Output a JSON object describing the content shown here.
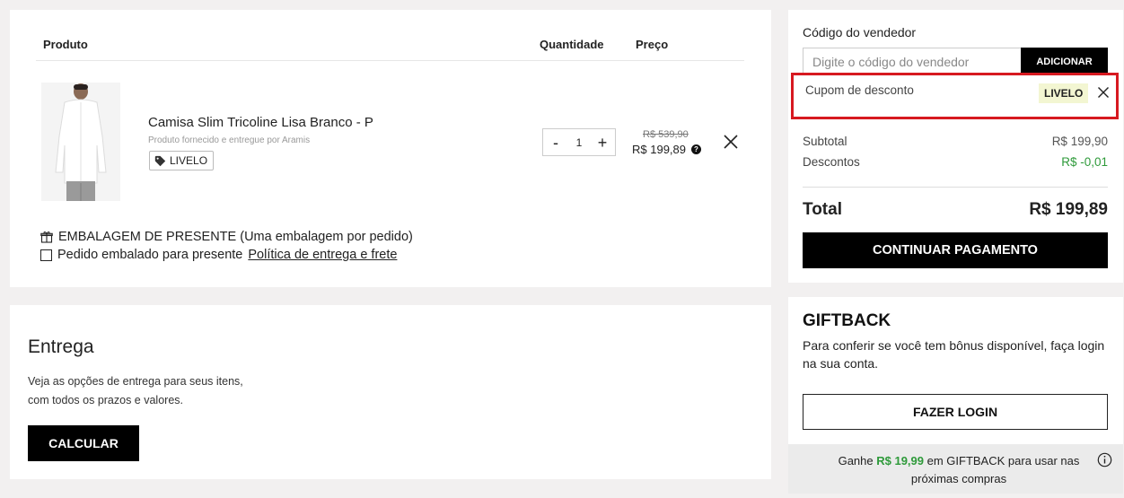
{
  "cart": {
    "headers": {
      "product": "Produto",
      "quantity": "Quantidade",
      "price": "Preço"
    },
    "item": {
      "name": "Camisa Slim Tricoline Lisa Branco - P",
      "seller": "Produto fornecido e entregue por Aramis",
      "coupon_tag": "LIVELO",
      "quantity": "1",
      "minus": "-",
      "plus": "+",
      "old_price": "R$ 539,90",
      "new_price": "R$ 199,89",
      "help": "?"
    },
    "gift_wrap": {
      "title": "EMBALAGEM DE PRESENTE (Uma embalagem por pedido)",
      "checkbox_label": "Pedido embalado para presente",
      "policy_link": "Política de entrega e frete"
    }
  },
  "delivery": {
    "title": "Entrega",
    "description": "Veja as opções de entrega para seus itens, com todos os prazos e valores.",
    "button": "CALCULAR"
  },
  "summary": {
    "seller_code_label": "Código do vendedor",
    "seller_code_placeholder": "Digite o código do vendedor",
    "seller_code_value": "",
    "add_button": "ADICIONAR",
    "coupon_label": "Cupom de desconto",
    "coupon_code": "LIVELO",
    "subtotal_label": "Subtotal",
    "subtotal_value": "R$ 199,90",
    "discount_label": "Descontos",
    "discount_value": "R$ -0,01",
    "total_label": "Total",
    "total_value": "R$ 199,89",
    "continue_button": "CONTINUAR PAGAMENTO"
  },
  "giftback": {
    "title": "GIFTBACK",
    "description": "Para conferir se você tem bônus disponível, faça login na sua conta.",
    "login_button": "FAZER LOGIN",
    "footer_prefix": "Ganhe ",
    "footer_amount": "R$ 19,99",
    "footer_suffix": " em GIFTBACK para usar nas próximas compras"
  },
  "colors": {
    "accent_green": "#2e9a3a",
    "highlight_red": "#d71920",
    "coupon_chip_bg": "#f3f6d2"
  }
}
